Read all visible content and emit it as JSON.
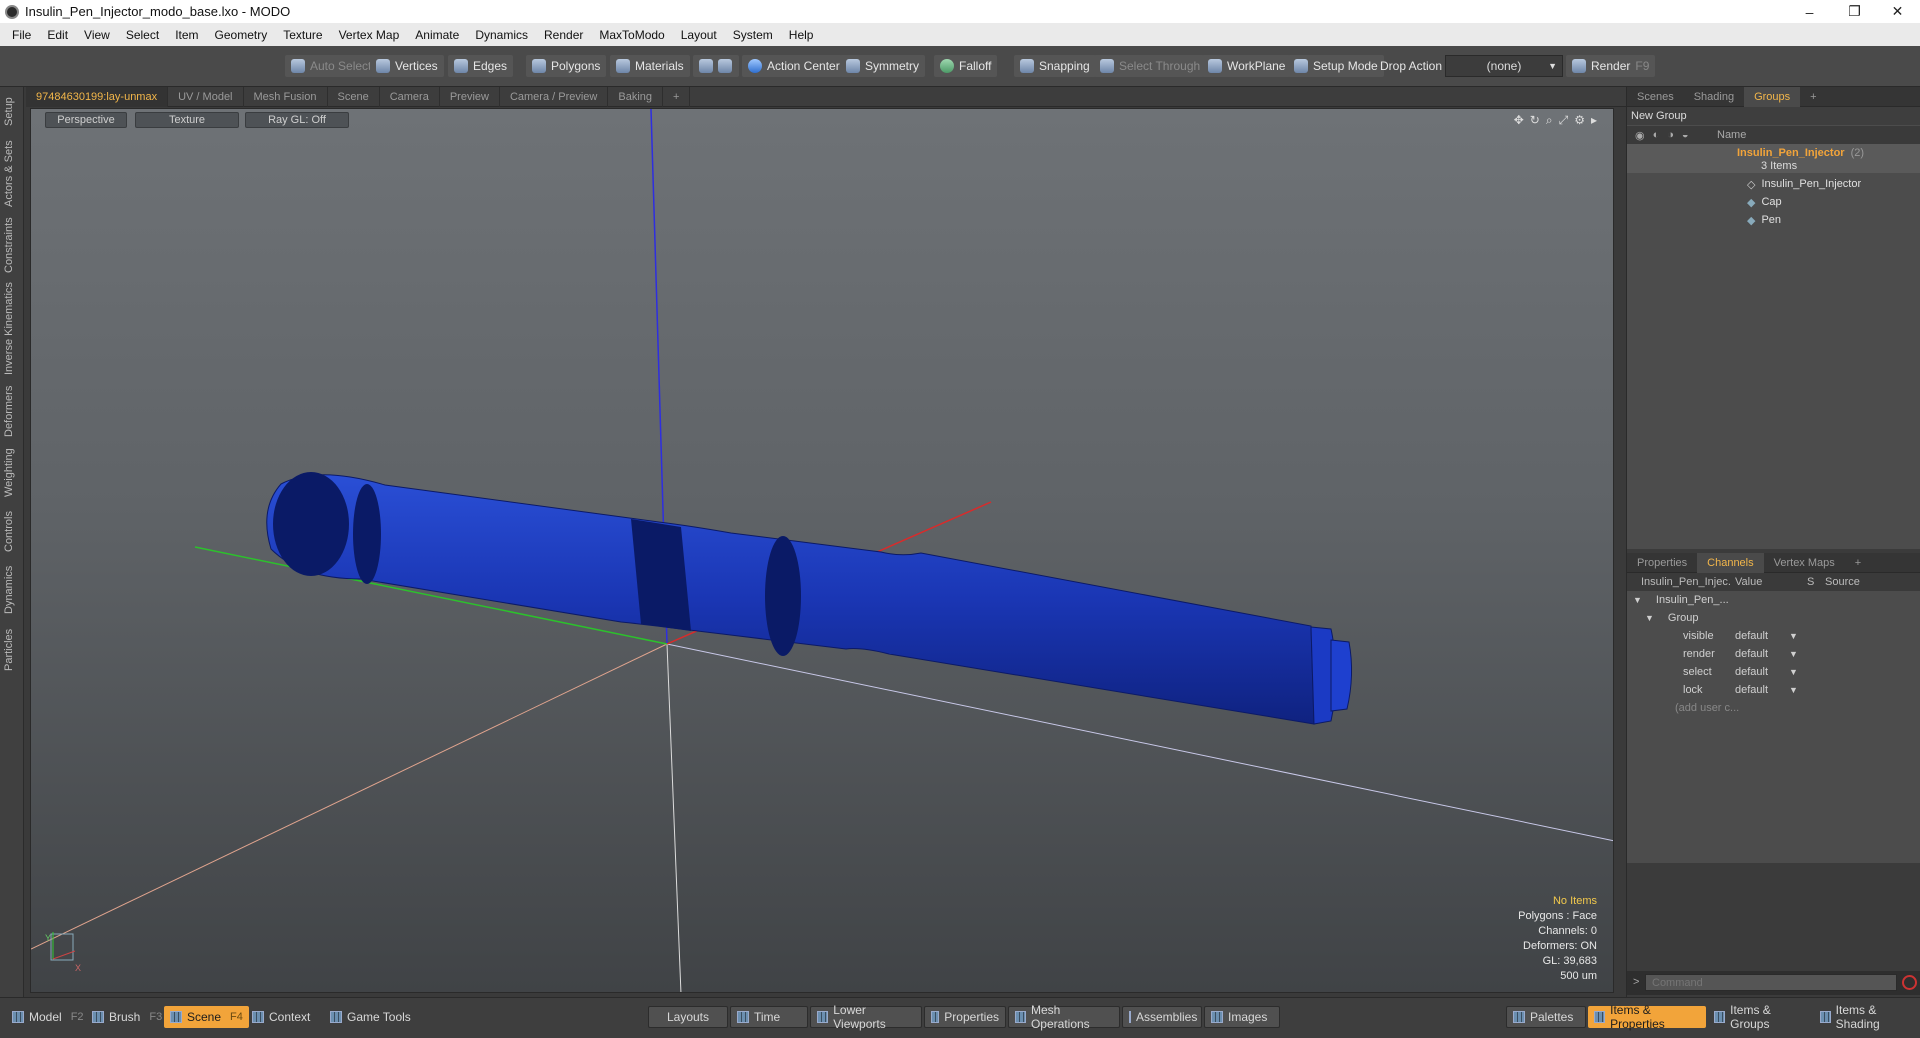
{
  "window": {
    "title": "Insulin_Pen_Injector_modo_base.lxo - MODO",
    "minimize": "–",
    "restore": "❐",
    "close": "✕"
  },
  "menu": [
    "File",
    "Edit",
    "View",
    "Select",
    "Item",
    "Geometry",
    "Texture",
    "Vertex Map",
    "Animate",
    "Dynamics",
    "Render",
    "MaxToModo",
    "Layout",
    "System",
    "Help"
  ],
  "toolbar": {
    "auto_select": "Auto Select",
    "vertices": "Vertices",
    "edges": "Edges",
    "polygons": "Polygons",
    "materials": "Materials",
    "action_center": "Action Center",
    "symmetry": "Symmetry",
    "falloff": "Falloff",
    "snapping": "Snapping",
    "select_through": "Select Through",
    "workplane": "WorkPlane",
    "setup_mode": "Setup Mode",
    "drop_action": "Drop Action",
    "drop_value": "(none)",
    "render": "Render",
    "render_key": "F9"
  },
  "left_tabs": [
    "Setup",
    "Actors & Sets",
    "Constraints",
    "Inverse Kinematics",
    "Deformers",
    "Weighting",
    "Controls",
    "Dynamics",
    "Particles"
  ],
  "viewport_tabs": [
    "97484630199:lay-unmax",
    "UV / Model",
    "Mesh Fusion",
    "Scene",
    "Camera",
    "Preview",
    "Camera / Preview",
    "Baking",
    "+"
  ],
  "viewport": {
    "view": "Perspective",
    "shading": "Texture",
    "raygl": "Ray GL: Off",
    "stats": {
      "selection": "No Items",
      "polygons": "Polygons : Face",
      "channels": "Channels: 0",
      "deformers": "Deformers: ON",
      "gl": "GL: 39,683",
      "unit": "500 um"
    },
    "axis_x": "X",
    "axis_y": "Y",
    "pen_color": "#1532a8"
  },
  "right_top_tabs": [
    "Scenes",
    "Shading",
    "Groups",
    "+"
  ],
  "groups": {
    "new_group": "New Group",
    "name_header": "Name",
    "root": "Insulin_Pen_Injector",
    "root_count": "(2)",
    "items_count": "3 Items",
    "children": [
      "Insulin_Pen_Injector",
      "Cap",
      "Pen"
    ]
  },
  "right_bottom_tabs": [
    "Properties",
    "Channels",
    "Vertex Maps",
    "+"
  ],
  "channels": {
    "col_item": "Insulin_Pen_Injec...",
    "col_value": "Value",
    "col_s": "S",
    "col_source": "Source",
    "tree_root": "Insulin_Pen_...",
    "tree_group": "Group",
    "rows": [
      {
        "name": "visible",
        "value": "default"
      },
      {
        "name": "render",
        "value": "default"
      },
      {
        "name": "select",
        "value": "default"
      },
      {
        "name": "lock",
        "value": "default"
      }
    ],
    "add_user": "(add user c..."
  },
  "command": {
    "prompt": ">",
    "placeholder": "Command"
  },
  "bottom_left": [
    {
      "label": "Model",
      "key": "F2"
    },
    {
      "label": "Brush",
      "key": "F3"
    },
    {
      "label": "Scene",
      "key": "F4"
    },
    {
      "label": "Context",
      "key": ""
    },
    {
      "label": "Game Tools",
      "key": ""
    }
  ],
  "bottom_mid": [
    "Layouts",
    "Time",
    "Lower Viewports",
    "Properties",
    "Mesh Operations",
    "Assemblies",
    "Images"
  ],
  "bottom_right": [
    "Palettes",
    "Items & Properties",
    "Items & Groups",
    "Items & Shading"
  ],
  "accent": "#f2a43a"
}
